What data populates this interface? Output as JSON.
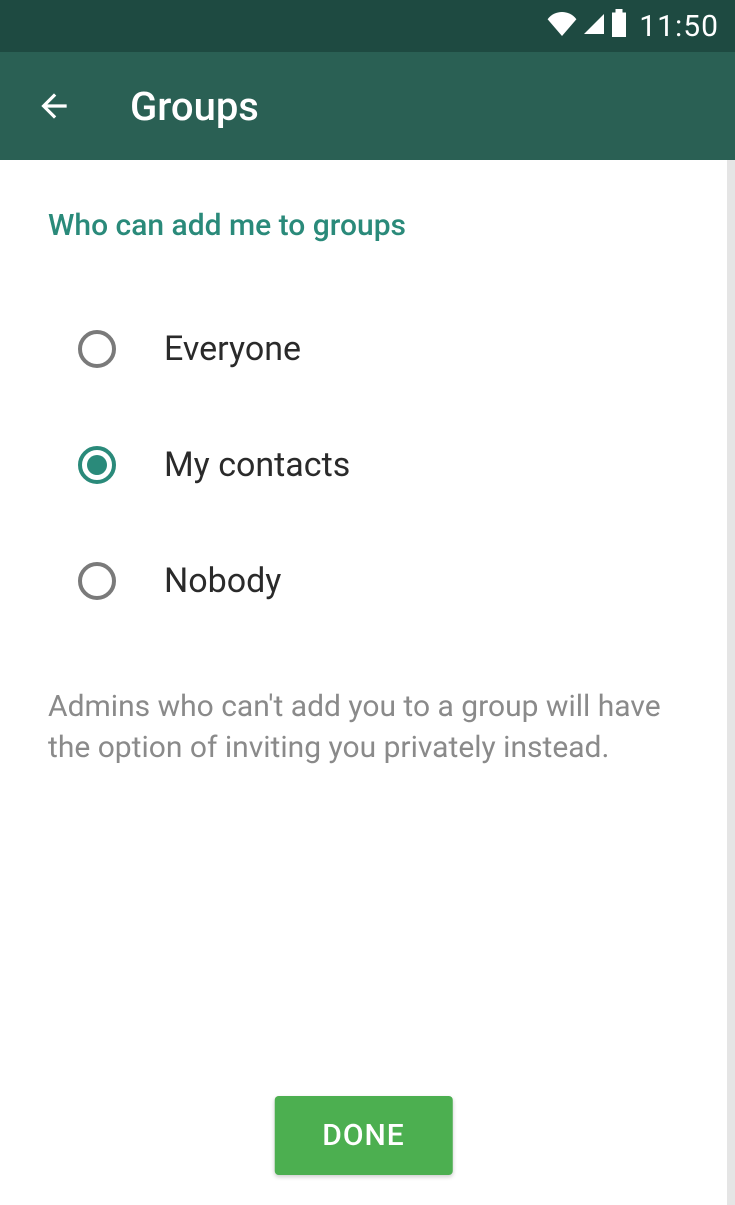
{
  "status": {
    "time": "11:50"
  },
  "appbar": {
    "title": "Groups"
  },
  "section": {
    "title": "Who can add me to groups"
  },
  "options": [
    {
      "label": "Everyone",
      "selected": false
    },
    {
      "label": "My contacts",
      "selected": true
    },
    {
      "label": "Nobody",
      "selected": false
    }
  ],
  "description": "Admins who can't add you to a group will have the option of inviting you privately instead.",
  "done_label": "DONE"
}
